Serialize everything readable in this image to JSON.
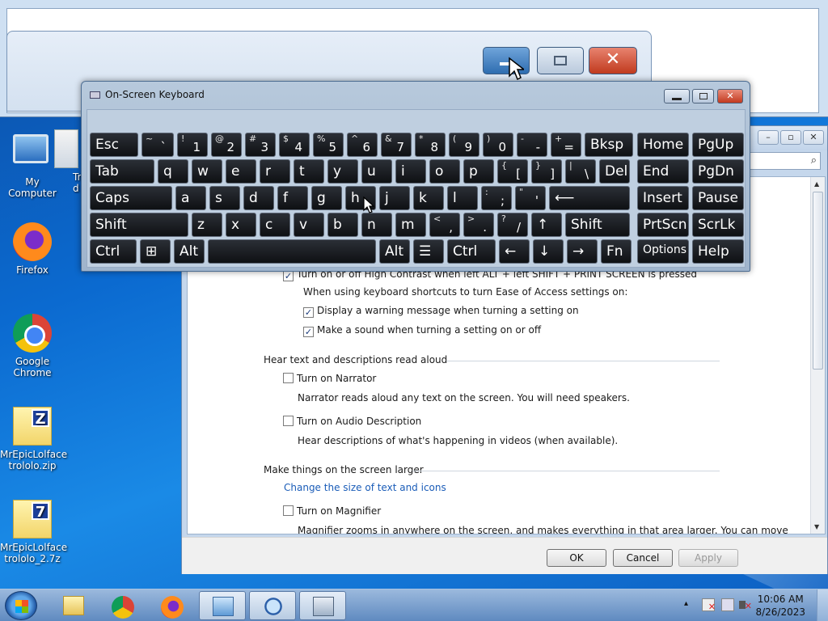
{
  "desktop": {
    "icons": [
      {
        "label": "My Computer"
      },
      {
        "label": "Tr\nd"
      },
      {
        "label": "Firefox"
      },
      {
        "label": "Google Chrome"
      },
      {
        "label": "MrEpicLolface trololo.zip",
        "badge": "Z"
      },
      {
        "label": "MrEpicLolface trololo_2.7z",
        "badge": "7"
      }
    ]
  },
  "osk": {
    "title": "On-Screen Keyboard",
    "rows": [
      [
        {
          "label": "Esc"
        },
        {
          "upper": "~",
          "lower": "`"
        },
        {
          "upper": "!",
          "lower": "1"
        },
        {
          "upper": "@",
          "lower": "2"
        },
        {
          "upper": "#",
          "lower": "3"
        },
        {
          "upper": "$",
          "lower": "4"
        },
        {
          "upper": "%",
          "lower": "5"
        },
        {
          "upper": "^",
          "lower": "6"
        },
        {
          "upper": "&",
          "lower": "7"
        },
        {
          "upper": "*",
          "lower": "8"
        },
        {
          "upper": "(",
          "lower": "9"
        },
        {
          "upper": ")",
          "lower": "0"
        },
        {
          "upper": "-",
          "lower": "-"
        },
        {
          "upper": "+",
          "lower": "="
        },
        {
          "label": "Bksp"
        },
        {
          "label": "Home"
        },
        {
          "label": "PgUp"
        }
      ],
      [
        {
          "label": "Tab"
        },
        {
          "label": "q"
        },
        {
          "label": "w"
        },
        {
          "label": "e"
        },
        {
          "label": "r"
        },
        {
          "label": "t"
        },
        {
          "label": "y"
        },
        {
          "label": "u"
        },
        {
          "label": "i"
        },
        {
          "label": "o"
        },
        {
          "label": "p"
        },
        {
          "upper": "{",
          "lower": "["
        },
        {
          "upper": "}",
          "lower": "]"
        },
        {
          "upper": "|",
          "lower": "\\"
        },
        {
          "label": "Del"
        },
        {
          "label": "End"
        },
        {
          "label": "PgDn"
        }
      ],
      [
        {
          "label": "Caps"
        },
        {
          "label": "a"
        },
        {
          "label": "s"
        },
        {
          "label": "d"
        },
        {
          "label": "f"
        },
        {
          "label": "g"
        },
        {
          "label": "h"
        },
        {
          "label": "j"
        },
        {
          "label": "k"
        },
        {
          "label": "l"
        },
        {
          "upper": ":",
          "lower": ";"
        },
        {
          "upper": "\"",
          "lower": "'"
        },
        {
          "label": "⟵"
        },
        {
          "label": "Insert"
        },
        {
          "label": "Pause"
        }
      ],
      [
        {
          "label": "Shift"
        },
        {
          "label": "z"
        },
        {
          "label": "x"
        },
        {
          "label": "c"
        },
        {
          "label": "v"
        },
        {
          "label": "b"
        },
        {
          "label": "n"
        },
        {
          "label": "m"
        },
        {
          "upper": "<",
          "lower": ","
        },
        {
          "upper": ">",
          "lower": "."
        },
        {
          "upper": "?",
          "lower": "/"
        },
        {
          "label": "↑"
        },
        {
          "label": "Shift"
        },
        {
          "label": "PrtScn"
        },
        {
          "label": "ScrLk"
        }
      ],
      [
        {
          "label": "Ctrl"
        },
        {
          "label": "⊞"
        },
        {
          "label": "Alt"
        },
        {
          "label": ""
        },
        {
          "label": "Alt"
        },
        {
          "label": "☰"
        },
        {
          "label": "Ctrl"
        },
        {
          "label": "←"
        },
        {
          "label": "↓"
        },
        {
          "label": "→"
        },
        {
          "label": "Fn"
        },
        {
          "label": "Options"
        },
        {
          "label": "Help"
        }
      ]
    ]
  },
  "ease": {
    "partial_line": "Turn on or off High Contrast when left ALT + left SHIFT + PRINT SCREEN is pressed",
    "shortcut_intro": "When using keyboard shortcuts to turn Ease of Access settings on:",
    "warn_label": "Display a warning message when turning a setting on",
    "sound_label": "Make a sound when turning a setting on or off",
    "section_narrator": "Hear text and descriptions read aloud",
    "narrator_label": "Turn on Narrator",
    "narrator_desc": "Narrator reads aloud any text on the screen. You will need speakers.",
    "audio_label": "Turn on Audio Description",
    "audio_desc": "Hear descriptions of what's happening in videos (when available).",
    "section_larger": "Make things on the screen larger",
    "size_link": "Change the size of text and icons",
    "magnifier_label": "Turn on Magnifier",
    "magnifier_desc": "Magnifier zooms in anywhere on the screen, and makes everything in that area larger. You can move",
    "ok": "OK",
    "cancel": "Cancel",
    "apply": "Apply"
  },
  "taskbar": {
    "time": "10:06 AM",
    "date": "8/26/2023",
    "tray_arrow": "▴"
  }
}
